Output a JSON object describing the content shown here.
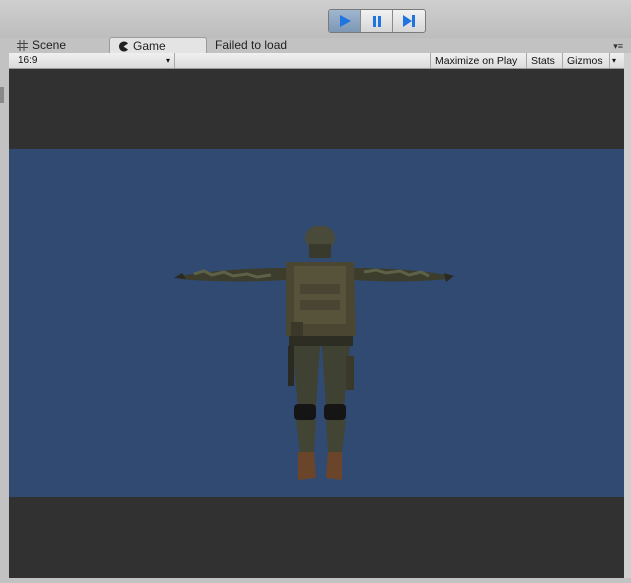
{
  "toolbar": {
    "play": {
      "icon": "play-icon",
      "active": true
    },
    "pause": {
      "icon": "pause-icon"
    },
    "step": {
      "icon": "step-icon"
    }
  },
  "tabs": {
    "scene": {
      "label": "Scene",
      "icon": "hash-icon"
    },
    "game": {
      "label": "Game",
      "icon": "pacman-icon"
    },
    "failed": {
      "label": "Failed to load"
    }
  },
  "game_toolbar": {
    "aspect_value": "16:9",
    "maximize_label": "Maximize on Play",
    "stats_label": "Stats",
    "gizmos_label": "Gizmos"
  },
  "colors": {
    "sky": "#304a72",
    "background": "#313131",
    "accent": "#2a6fd6"
  }
}
